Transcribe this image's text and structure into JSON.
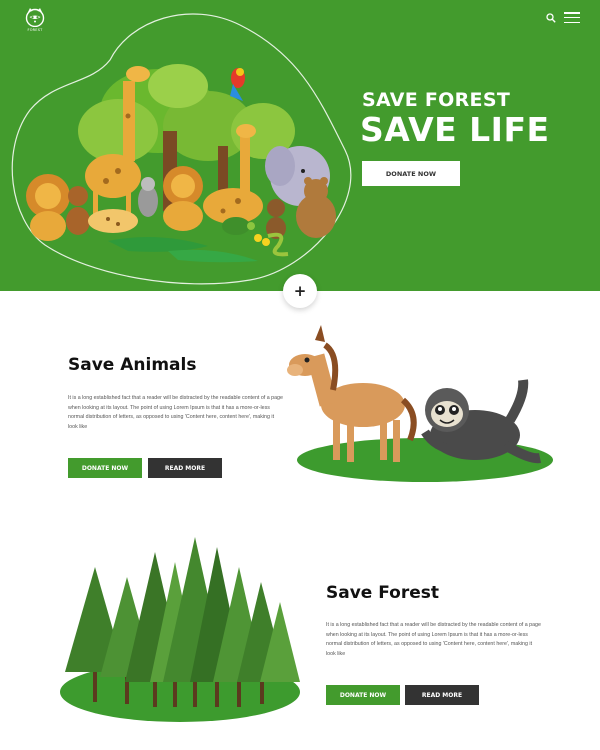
{
  "header": {
    "logo_text": "FOREST",
    "icons": [
      "search-icon",
      "menu-icon"
    ]
  },
  "hero": {
    "subtitle": "SAVE FOREST",
    "title": "SAVE LIFE",
    "button_label": "DONATE NOW",
    "plus_label": "+"
  },
  "animals": {
    "title": "Save Animals",
    "text": "It is a long established fact that a reader will be distracted by the readable content of a page when looking at its layout. The point of using Lorem Ipsum is that it has a more-or-less normal distribution of letters, as opposed to using 'Content here, content here', making it look like",
    "donate_label": "DONATE NOW",
    "more_label": "READ MORE"
  },
  "forest": {
    "title": "Save Forest",
    "text": "It is a long established fact that a reader will be distracted by the readable content of a page when looking at its layout. The point of using Lorem Ipsum is that it has a more-or-less normal distribution of letters, as opposed to using 'Content here, content here', making it look like",
    "donate_label": "DONATE NOW",
    "more_label": "READ MORE"
  },
  "colors": {
    "brand_green": "#439b2d",
    "dark": "#333333",
    "white": "#ffffff"
  }
}
